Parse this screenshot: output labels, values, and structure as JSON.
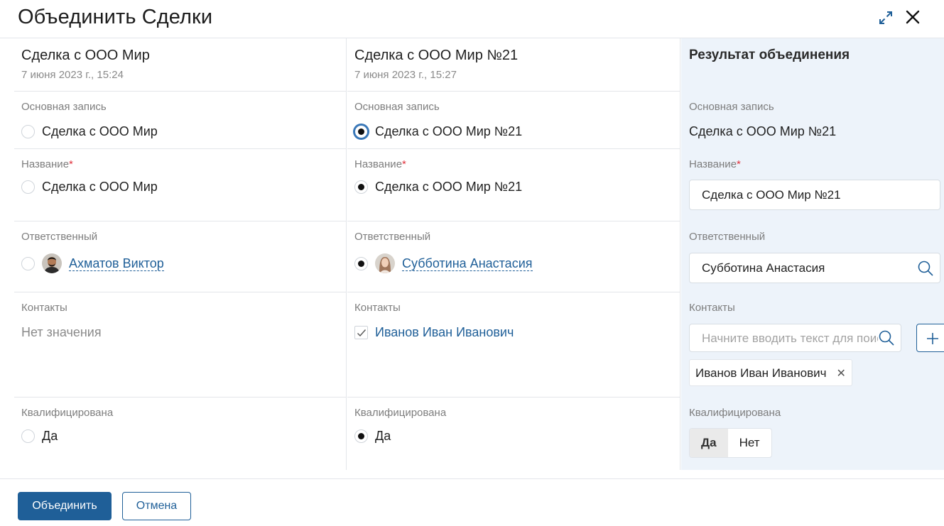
{
  "dialog": {
    "title": "Объединить Сделки"
  },
  "left": {
    "deal_title": "Сделка с ООО Мир",
    "deal_date": "7 июня 2023 г., 15:24",
    "main_record_label": "Основная запись",
    "main_record_value": "Сделка с ООО Мир",
    "name_label": "Название",
    "name_value": "Сделка с ООО Мир",
    "responsible_label": "Ответственный",
    "responsible_value": "Ахматов Виктор",
    "contacts_label": "Контакты",
    "contacts_value": "Нет значения",
    "qualified_label": "Квалифицирована",
    "qualified_value": "Да"
  },
  "middle": {
    "deal_title": "Сделка с ООО Мир №21",
    "deal_date": "7 июня 2023 г., 15:27",
    "main_record_label": "Основная запись",
    "main_record_value": "Сделка с ООО Мир №21",
    "name_label": "Название",
    "name_value": "Сделка с ООО Мир №21",
    "responsible_label": "Ответственный",
    "responsible_value": "Субботина Анастасия",
    "contacts_label": "Контакты",
    "contacts_value": "Иванов Иван Иванович",
    "qualified_label": "Квалифицирована",
    "qualified_value": "Да"
  },
  "result": {
    "title": "Результат объединения",
    "main_record_label": "Основная запись",
    "main_record_value": "Сделка с ООО Мир №21",
    "name_label": "Название",
    "name_value": "Сделка с ООО Мир №21",
    "responsible_label": "Ответственный",
    "responsible_value": "Субботина Анастасия",
    "contacts_label": "Контакты",
    "contacts_placeholder": "Начните вводить текст для поиска",
    "contact_chip": "Иванов Иван Иванович",
    "qualified_label": "Квалифицирована",
    "qualified_yes": "Да",
    "qualified_no": "Нет"
  },
  "required_mark": "*",
  "footer": {
    "merge_label": "Объединить",
    "cancel_label": "Отмена"
  },
  "colors": {
    "accent": "#1f5f98",
    "result_bg": "#edf3fa",
    "required": "#e0323c"
  },
  "icons": [
    "expand-icon",
    "close-icon",
    "search-icon",
    "plus-icon",
    "remove-icon",
    "checkmark-icon"
  ]
}
